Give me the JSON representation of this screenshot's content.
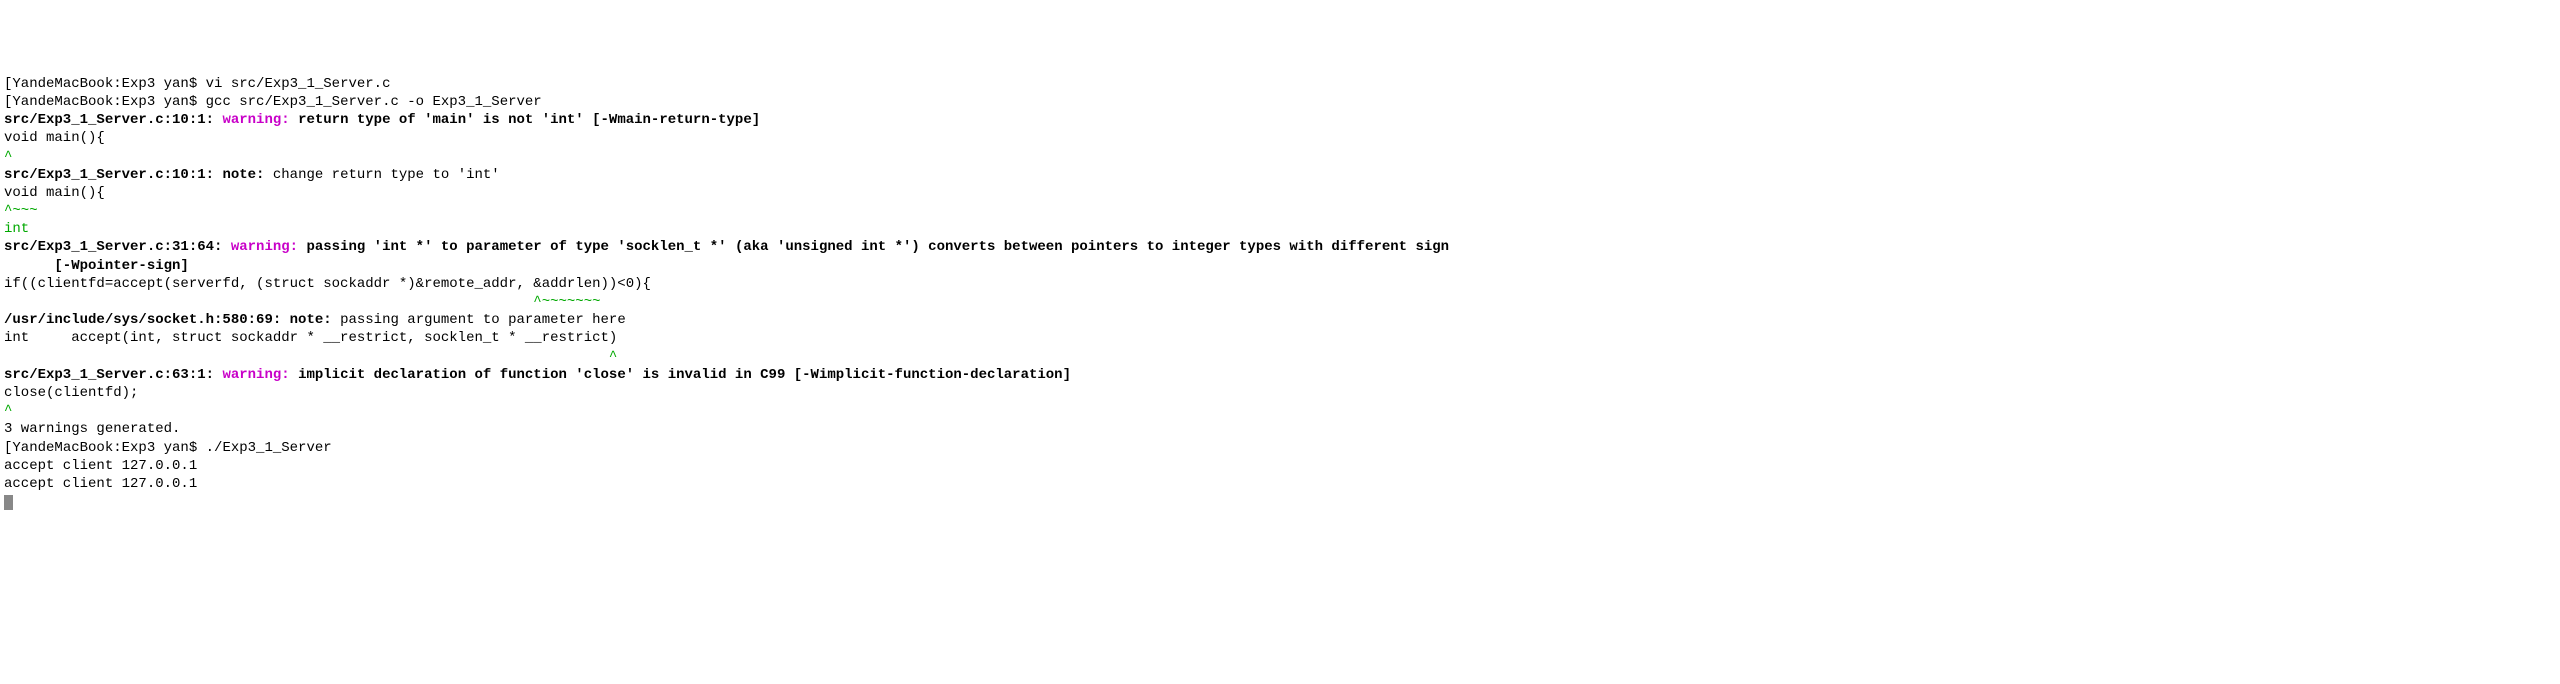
{
  "lines": {
    "l1_bracket": "[",
    "l1_prompt": "YandeMacBook:Exp3 yan$ ",
    "l1_cmd": "vi src/Exp3_1_Server.c",
    "l2_bracket": "[",
    "l2_prompt": "YandeMacBook:Exp3 yan$ ",
    "l2_cmd": "gcc src/Exp3_1_Server.c -o Exp3_1_Server",
    "l3_loc": "src/Exp3_1_Server.c:10:1: ",
    "l3_warn": "warning: ",
    "l3_msg": "return type of 'main' is not 'int' [-Wmain-return-type]",
    "l4": "void main(){",
    "l5": "^",
    "l6_loc": "src/Exp3_1_Server.c:10:1: ",
    "l6_note": "note: ",
    "l6_msg": "change return type to 'int'",
    "l7": "void main(){",
    "l8": "^~~~",
    "l9": "int",
    "l10_loc": "src/Exp3_1_Server.c:31:64: ",
    "l10_warn": "warning: ",
    "l10_msg": "passing 'int *' to parameter of type 'socklen_t *' (aka 'unsigned int *') converts between pointers to integer types with different sign",
    "l11": "      [-Wpointer-sign]",
    "l12": "if((clientfd=accept(serverfd, (struct sockaddr *)&remote_addr, &addrlen))<0){",
    "l13": "                                                               ^~~~~~~~",
    "l14_loc": "/usr/include/sys/socket.h:580:69: ",
    "l14_note": "note: ",
    "l14_msg": "passing argument to parameter here",
    "l15": "int     accept(int, struct sockaddr * __restrict, socklen_t * __restrict)",
    "l16": "                                                                        ^",
    "l17_loc": "src/Exp3_1_Server.c:63:1: ",
    "l17_warn": "warning: ",
    "l17_msg": "implicit declaration of function 'close' is invalid in C99 [-Wimplicit-function-declaration]",
    "l18": "close(clientfd);",
    "l19": "^",
    "l20": "3 warnings generated.",
    "l21_bracket": "[",
    "l21_prompt": "YandeMacBook:Exp3 yan$ ",
    "l21_cmd": "./Exp3_1_Server",
    "l22": "accept client 127.0.0.1",
    "l23": "accept client 127.0.0.1"
  }
}
